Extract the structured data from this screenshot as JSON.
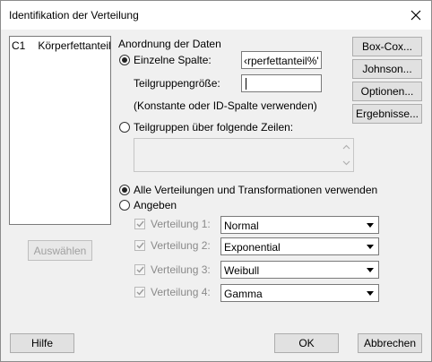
{
  "window": {
    "title": "Identifikation der Verteilung"
  },
  "variables": {
    "items": [
      {
        "column": "C1",
        "name": "Körperfettanteil%"
      }
    ],
    "select_button": "Auswählen"
  },
  "arrangement": {
    "heading": "Anordnung der Daten",
    "single_column": {
      "label": "Einzelne Spalte:",
      "value": "‹rperfettanteil%'",
      "selected": true
    },
    "subgroup_size": {
      "label": "Teilgruppengröße:",
      "value": "",
      "hint": "(Konstante oder ID-Spalte verwenden)"
    },
    "subgroups_across_rows": {
      "label": "Teilgruppen über folgende Zeilen:",
      "selected": false
    }
  },
  "distributions": {
    "use_all": {
      "label": "Alle Verteilungen und Transformationen verwenden",
      "selected": true
    },
    "specify": {
      "label": "Angeben",
      "selected": false
    },
    "rows": [
      {
        "label": "Verteilung 1:",
        "checked": true,
        "value": "Normal"
      },
      {
        "label": "Verteilung 2:",
        "checked": true,
        "value": "Exponential"
      },
      {
        "label": "Verteilung 3:",
        "checked": true,
        "value": "Weibull"
      },
      {
        "label": "Verteilung 4:",
        "checked": true,
        "value": "Gamma"
      }
    ]
  },
  "side_buttons": {
    "box_cox": "Box-Cox...",
    "johnson": "Johnson...",
    "options": "Optionen...",
    "results": "Ergebnisse..."
  },
  "footer": {
    "help": "Hilfe",
    "ok": "OK",
    "cancel": "Abbrechen"
  }
}
